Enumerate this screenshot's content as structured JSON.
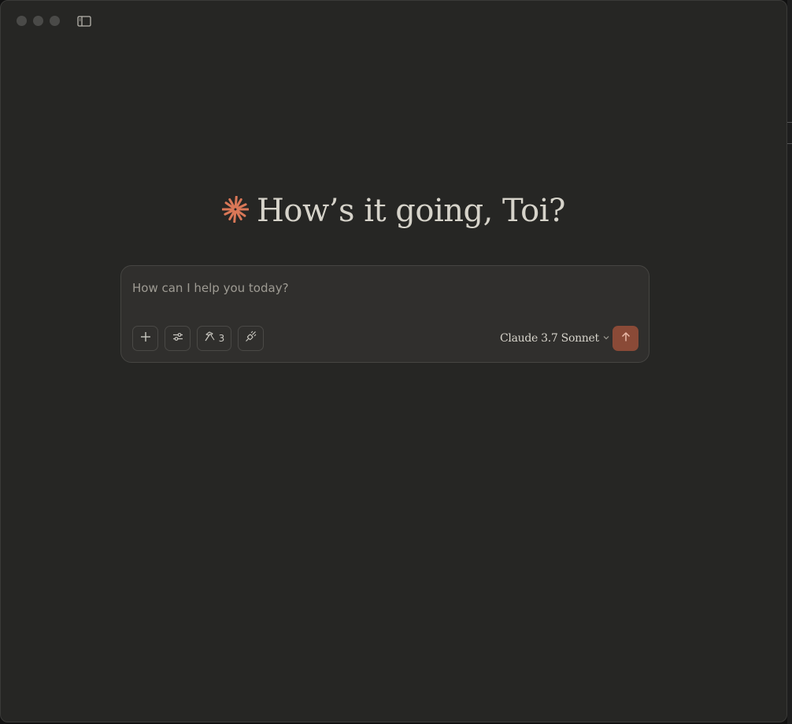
{
  "window": {
    "greeting": "How’s it going, Toi?"
  },
  "composer": {
    "placeholder": "How can I help you today?",
    "tools_count": "3",
    "model_name": "Claude 3.7 Sonnet"
  },
  "colors": {
    "background": "#262624",
    "composer": "#302f2d",
    "accent": "#d97757",
    "send_button": "#8a4a37"
  },
  "icons": {
    "traffic_lights": "window-controls",
    "sidebar": "sidebar-toggle-icon",
    "logo": "claude-starburst-icon",
    "add": "plus-icon",
    "settings": "sliders-icon",
    "tools": "hammer-icon",
    "integrations": "plug-icon",
    "dropdown": "chevron-down-icon",
    "send": "arrow-up-icon"
  }
}
